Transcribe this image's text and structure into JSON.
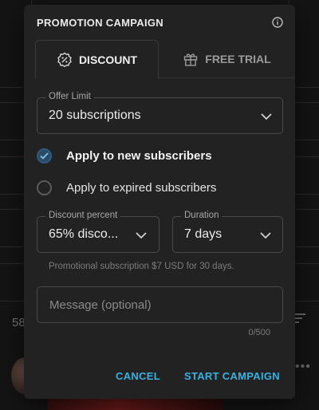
{
  "background": {
    "partial_number": "58",
    "dots": "•••"
  },
  "dialog": {
    "title": "PROMOTION CAMPAIGN",
    "tabs": [
      {
        "label": "DISCOUNT",
        "icon": "discount-badge-icon",
        "active": true
      },
      {
        "label": "FREE TRIAL",
        "icon": "gift-icon",
        "active": false
      }
    ],
    "offer_limit": {
      "label": "Offer Limit",
      "value": "20 subscriptions"
    },
    "audience": [
      {
        "label": "Apply to new subscribers",
        "checked": true
      },
      {
        "label": "Apply to expired subscribers",
        "checked": false
      }
    ],
    "discount_percent": {
      "label": "Discount percent",
      "value": "65% disco..."
    },
    "duration": {
      "label": "Duration",
      "value": "7 days"
    },
    "hint": "Promotional subscription $7 USD for 30 days.",
    "message": {
      "placeholder": "Message (optional)",
      "counter": "0/500"
    },
    "actions": {
      "cancel": "CANCEL",
      "start": "START CAMPAIGN"
    }
  },
  "colors": {
    "accent": "#3ab0e0",
    "dialog_bg": "#222222",
    "page_bg": "#141414",
    "radio_checked": "#2a4a66"
  }
}
